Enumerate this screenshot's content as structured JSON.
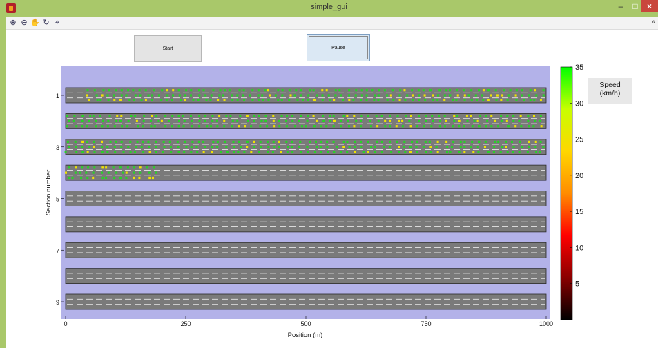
{
  "window": {
    "title": "simple_gui",
    "min": "–",
    "max": "□",
    "close": "×"
  },
  "toolbar": {
    "tools": [
      "zoom-in-icon",
      "zoom-out-icon",
      "pan-hand-icon",
      "rotate-3d-icon",
      "data-cursor-icon"
    ],
    "more": "»"
  },
  "controls": {
    "start_label": "Start",
    "pause_label": "Pause"
  },
  "colors": {
    "plot_bg": "#b3b2e9",
    "road": "#7a7a7a",
    "lane_line": "#e8e8e8",
    "car_fast": "#27d327",
    "car_mid": "#f0e400"
  },
  "colorbar": {
    "label": "Speed (km/h)",
    "label_line1": "Speed",
    "label_line2": "(km/h)",
    "range": [
      0,
      35
    ],
    "ticks": [
      5,
      10,
      15,
      20,
      25,
      30,
      35
    ],
    "colormap": [
      "#000000",
      "#8a0000",
      "#ff0000",
      "#ff8c00",
      "#ffd700",
      "#c8ff00",
      "#00ff00"
    ]
  },
  "chart_data": {
    "type": "scatter",
    "xlabel": "Position (m)",
    "ylabel": "Section number",
    "xlim": [
      0,
      1000
    ],
    "ylim": [
      9.5,
      0.5
    ],
    "y_reversed": true,
    "xticks": [
      0,
      250,
      500,
      750,
      1000
    ],
    "yticks": [
      1,
      3,
      5,
      7,
      9
    ],
    "sections": [
      1,
      2,
      3,
      4,
      5,
      6,
      7,
      8,
      9
    ],
    "lanes_per_section": 3,
    "occupied_range_m": [
      [
        45,
        1000
      ],
      [
        0,
        1000
      ],
      [
        0,
        1000
      ],
      [
        0,
        195
      ],
      [
        0,
        0
      ],
      [
        0,
        0
      ],
      [
        0,
        0
      ],
      [
        0,
        0
      ],
      [
        0,
        0
      ]
    ],
    "car_density_per_lane_per_km": [
      [
        74,
        74,
        74
      ],
      [
        70,
        70,
        70
      ],
      [
        70,
        70,
        70
      ],
      [
        70,
        70,
        70
      ],
      [
        0,
        0,
        0
      ],
      [
        0,
        0,
        0
      ],
      [
        0,
        0,
        0
      ],
      [
        0,
        0,
        0
      ],
      [
        0,
        0,
        0
      ]
    ],
    "slow_fraction": [
      0.15,
      0.15,
      0.15,
      0.22,
      0,
      0,
      0,
      0,
      0
    ],
    "speed_fast_kmh": 30,
    "speed_slow_kmh": 22
  }
}
